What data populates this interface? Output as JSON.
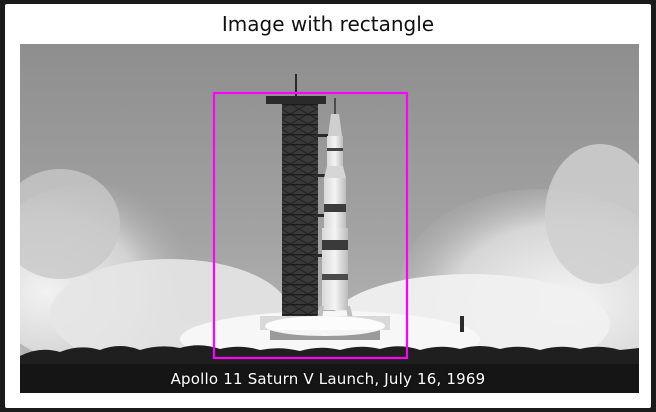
{
  "figure": {
    "title": "Image with rectangle"
  },
  "photo": {
    "caption": "Apollo 11 Saturn V Launch, July 16, 1969",
    "rectangle_color": "#ff00ff"
  }
}
